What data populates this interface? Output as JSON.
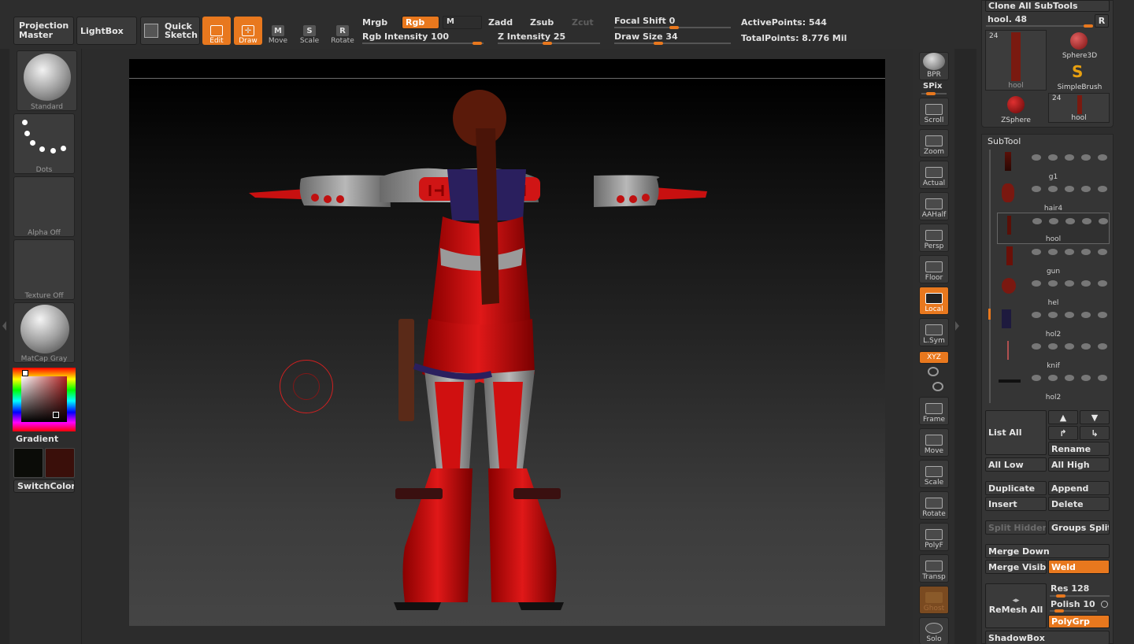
{
  "topbar": {
    "projection_master": "Projection Master",
    "lightbox": "LightBox",
    "quick_sketch": "Quick Sketch",
    "edit": "Edit",
    "draw": "Draw",
    "move": "Move",
    "scale": "Scale",
    "rotate": "Rotate",
    "mrgb": "Mrgb",
    "rgb": "Rgb",
    "m": "M",
    "zadd": "Zadd",
    "zsub": "Zsub",
    "zcut": "Zcut",
    "rgb_intensity_label": "Rgb Intensity 100",
    "z_intensity_label": "Z Intensity 25",
    "focal_shift_label": "Focal Shift 0",
    "draw_size_label": "Draw Size 34",
    "active_points": "ActivePoints: 544",
    "total_points": "TotalPoints: 8.776 Mil",
    "rgb_intensity": 100,
    "z_intensity": 25,
    "focal_shift": 0,
    "draw_size": 34
  },
  "left": {
    "brush": "Standard",
    "stroke": "Dots",
    "alpha": "Alpha Off",
    "texture": "Texture Off",
    "material": "MatCap Gray",
    "gradient": "Gradient",
    "switch_color": "SwitchColor",
    "main_color": "#0b0c08",
    "secondary_color": "#3a0f0a"
  },
  "right_toolbar": {
    "bpr": "BPR",
    "spix": "SPix",
    "scroll": "Scroll",
    "zoom": "Zoom",
    "actual": "Actual",
    "aahalf": "AAHalf",
    "persp": "Persp",
    "floor": "Floor",
    "local": "Local",
    "lsym": "L.Sym",
    "xyz": "XYZ",
    "frame": "Frame",
    "move": "Move",
    "scale": "Scale",
    "rotate": "Rotate",
    "polyf": "PolyF",
    "transp": "Transp",
    "ghost": "Ghost",
    "solo": "Solo"
  },
  "tool_panel": {
    "clone_all": "Clone All SubTools",
    "hool_label": "hool. 48",
    "r": "R",
    "tools": [
      {
        "name": "hool",
        "count": "24"
      },
      {
        "name": "Sphere3D"
      },
      {
        "name": "SimpleBrush"
      },
      {
        "name": "ZSphere"
      },
      {
        "name": "hool",
        "count": "24"
      }
    ]
  },
  "subtool": {
    "title": "SubTool",
    "items": [
      {
        "name": "g1"
      },
      {
        "name": "hair4"
      },
      {
        "name": "hool"
      },
      {
        "name": "gun"
      },
      {
        "name": "hel"
      },
      {
        "name": "hol2"
      },
      {
        "name": "knif"
      },
      {
        "name": "hol2"
      }
    ],
    "list_all": "List All",
    "rename": "Rename",
    "all_low": "All Low",
    "all_high": "All High",
    "duplicate": "Duplicate",
    "append": "Append",
    "insert": "Insert",
    "delete": "Delete",
    "split_hidden": "Split Hidden",
    "groups_split": "Groups Split",
    "merge_down": "Merge Down",
    "merge_visible": "Merge Visible",
    "weld": "Weld",
    "remesh_all": "ReMesh All",
    "res": "Res 128",
    "polish": "Polish 10",
    "polygrp": "PolyGrp",
    "shadowbox": "ShadowBox"
  }
}
